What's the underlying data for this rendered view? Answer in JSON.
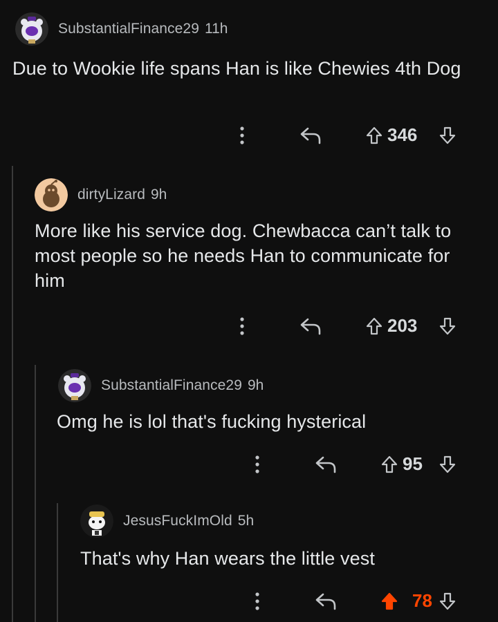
{
  "comments": [
    {
      "username": "SubstantialFinance29",
      "time": "11h",
      "text": "Due to Wookie life spans Han is like Chewies 4th Dog",
      "score": "346",
      "upvoted": false
    },
    {
      "username": "dirtyLizard",
      "time": "9h",
      "text": "More like his service dog. Chewbacca can’t talk to most people so he needs Han to communicate for him",
      "score": "203",
      "upvoted": false
    },
    {
      "username": "SubstantialFinance29",
      "time": "9h",
      "text": "Omg he is lol that's fucking hysterical",
      "score": "95",
      "upvoted": false
    },
    {
      "username": "JesusFuckImOld",
      "time": "5h",
      "text": "That's why Han wears the little vest",
      "score": "78",
      "upvoted": true
    }
  ],
  "colors": {
    "background": "#0f0f0f",
    "text": "#e6e8ea",
    "meta": "#b8bbbe",
    "thread_line": "#3a3a3a",
    "upvote_active": "#ff4500"
  },
  "icons": {
    "more": "more-vertical-icon",
    "reply": "reply-icon",
    "upvote": "upvote-arrow-icon",
    "downvote": "downvote-arrow-icon"
  }
}
